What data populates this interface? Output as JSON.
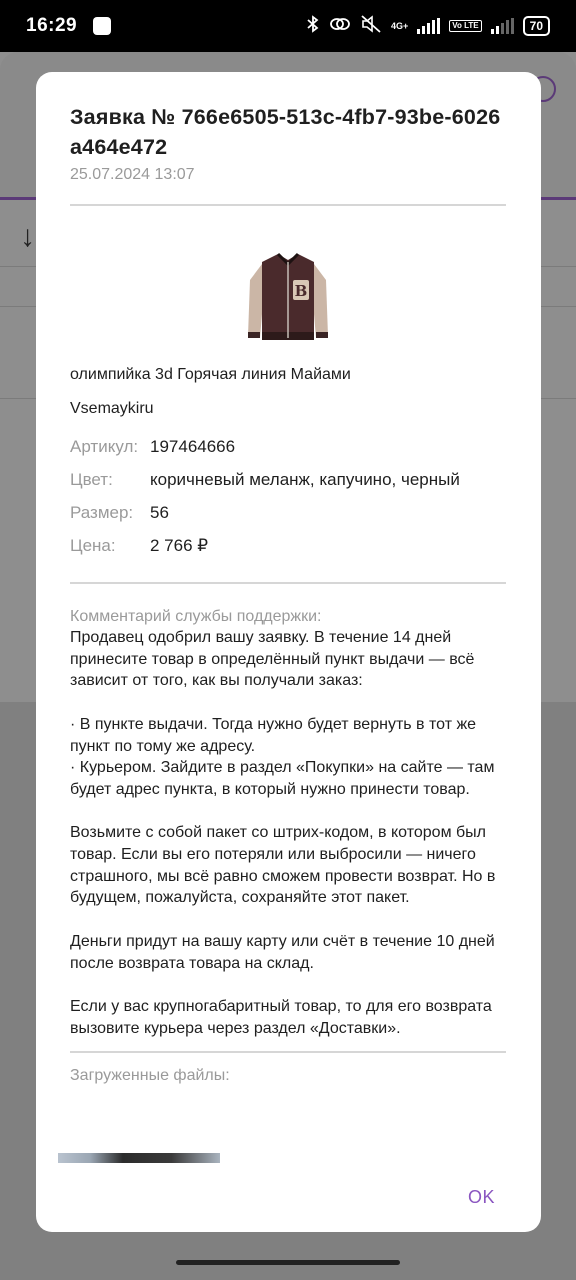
{
  "status_bar": {
    "time": "16:29",
    "battery": "70",
    "network": "4G+",
    "volte": "Vo LTE",
    "icons": [
      "bluetooth-icon",
      "link-icon",
      "mute-icon",
      "signal-icon",
      "wifi-icon"
    ]
  },
  "dialog": {
    "title": "Заявка № 766e6505-513c-4fb7-93be-6026a464e472",
    "date": "25.07.2024 13:07",
    "product": {
      "name": "олимпийка 3d Горячая линия Майами",
      "seller": "Vsemaykiru",
      "image_icon": "jacket-image"
    },
    "attributes": [
      {
        "label": "Артикул:",
        "value": "197464666"
      },
      {
        "label": "Цвет:",
        "value": "коричневый меланж, капучино, черный"
      },
      {
        "label": "Размер:",
        "value": "56"
      },
      {
        "label": "Цена:",
        "value": "2 766 ₽"
      }
    ],
    "comment_label": "Комментарий службы поддержки:",
    "comment": "Продавец одобрил вашу заявку. В течение 14 дней принесите товар в определённый пункт выдачи — всё зависит от того, как вы получали заказ:\n\n· В пункте выдачи. Тогда нужно будет вернуть в тот же пункт по тому же адресу.\n· Курьером. Зайдите в раздел «Покупки» на сайте — там будет адрес пункта, в который нужно принести товар.\n\nВозьмите с собой пакет со штрих-кодом, в котором был товар. Если вы его потеряли или выбросили — ничего страшного, мы всё равно сможем провести возврат. Но в будущем, пожалуйста, сохраняйте этот пакет.\n\nДеньги придут на вашу карту или счёт в течение 10 дней после возврата товара на склад.\n\nЕсли у вас крупногабаритный товар, то для его возврата вызовите курьера через раздел «Доставки».",
    "files_label": "Загруженные файлы:",
    "ok_label": "OK"
  },
  "colors": {
    "accent": "#8a55c0",
    "muted_text": "#9a9a9a",
    "overlay": "#8e8e8e"
  }
}
